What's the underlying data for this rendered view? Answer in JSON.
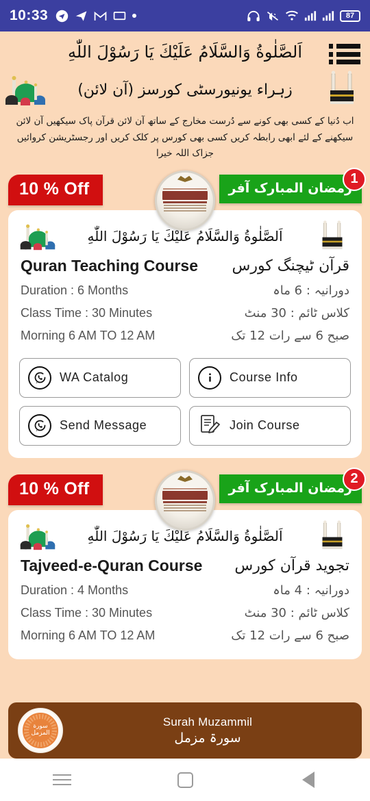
{
  "statusbar": {
    "time": "10:33",
    "battery": "87",
    "icons": [
      "telegram-icon",
      "send-icon",
      "gmail-icon",
      "screen-cast-icon",
      "dot-indicator",
      "headphones-icon",
      "vibrate-icon",
      "wifi-icon",
      "signal-icon-1",
      "signal-icon-2",
      "battery-icon"
    ]
  },
  "header": {
    "calligraphy": "اَلصَّلٰوةُ وَالسَّلَامُ عَلَيْكَ يَا رَسُوْلَ اللّٰهِ",
    "university_title": "زہراء یونیورسٹی کورسز (آن لائن)",
    "description_line1": "اب دُنیا کے کسی بھی کونے سے دُرست مخارج کے ساتھ آن لائن قرآن پاک سیکھیں آن لائن",
    "description_line2": "سیکھنے کے لئے ابھی رابطہ کریں کسی بھی کورس پر کلک کریں اور رجسٹریشن کروائیں جزاک اللہ خیرا",
    "menu_label": "menu"
  },
  "cards": [
    {
      "number": "1",
      "discount_badge": "10 % Off",
      "offer_badge": "رمضان المبارک آفر",
      "calligraphy": "اَلصَّلٰوةُ وَالسَّلَامُ عَلَيْكَ يَا رَسُوْلَ اللّٰهِ",
      "title_en": "Quran Teaching Course",
      "title_ur": "قرآن ٹیچنگ کورس",
      "details": [
        {
          "en": "Duration : 6 Months",
          "ur": "دورانیہ : 6 ماہ"
        },
        {
          "en": "Class Time : 30 Minutes",
          "ur": "کلاس ٹائم : 30 منٹ"
        },
        {
          "en": "Morning 6 AM TO 12 AM",
          "ur": "صبح 6 سے رات 12 تک"
        }
      ],
      "buttons": [
        {
          "label": "WA Catalog",
          "icon": "whatsapp-icon"
        },
        {
          "label": "Course Info",
          "icon": "info-icon"
        },
        {
          "label": "Send Message",
          "icon": "whatsapp-icon"
        },
        {
          "label": "Join Course",
          "icon": "signup-form-icon"
        }
      ]
    },
    {
      "number": "2",
      "discount_badge": "10 % Off",
      "offer_badge": "رمضان المبارک آفر",
      "calligraphy": "اَلصَّلٰوةُ وَالسَّلَامُ عَلَيْكَ يَا رَسُوْلَ اللّٰهِ",
      "title_en": "Tajveed-e-Quran Course",
      "title_ur": "تجوید قرآن کورس",
      "details": [
        {
          "en": "Duration : 4 Months",
          "ur": "دورانیہ : 4 ماہ"
        },
        {
          "en": "Class Time : 30 Minutes",
          "ur": "کلاس ٹائم : 30 منٹ"
        },
        {
          "en": "Morning 6 AM TO 12 AM",
          "ur": "صبح 6 سے رات 12 تک"
        }
      ],
      "buttons": []
    }
  ],
  "player": {
    "title_en": "Surah Muzammil",
    "title_ur": "سورۃ مزمل",
    "emblem_text": "سورة المزمل"
  },
  "navbar": {
    "recents": "recents",
    "home": "home",
    "back": "back"
  },
  "colors": {
    "page_bg": "#fbd9ba",
    "statusbar": "#3b3fa0",
    "discount_red": "#d10f10",
    "offer_green": "#19a319",
    "number_badge_red": "#e01b24",
    "player_brown": "#7a3f14",
    "player_accent": "#e8833c",
    "card_white": "#ffffff"
  }
}
